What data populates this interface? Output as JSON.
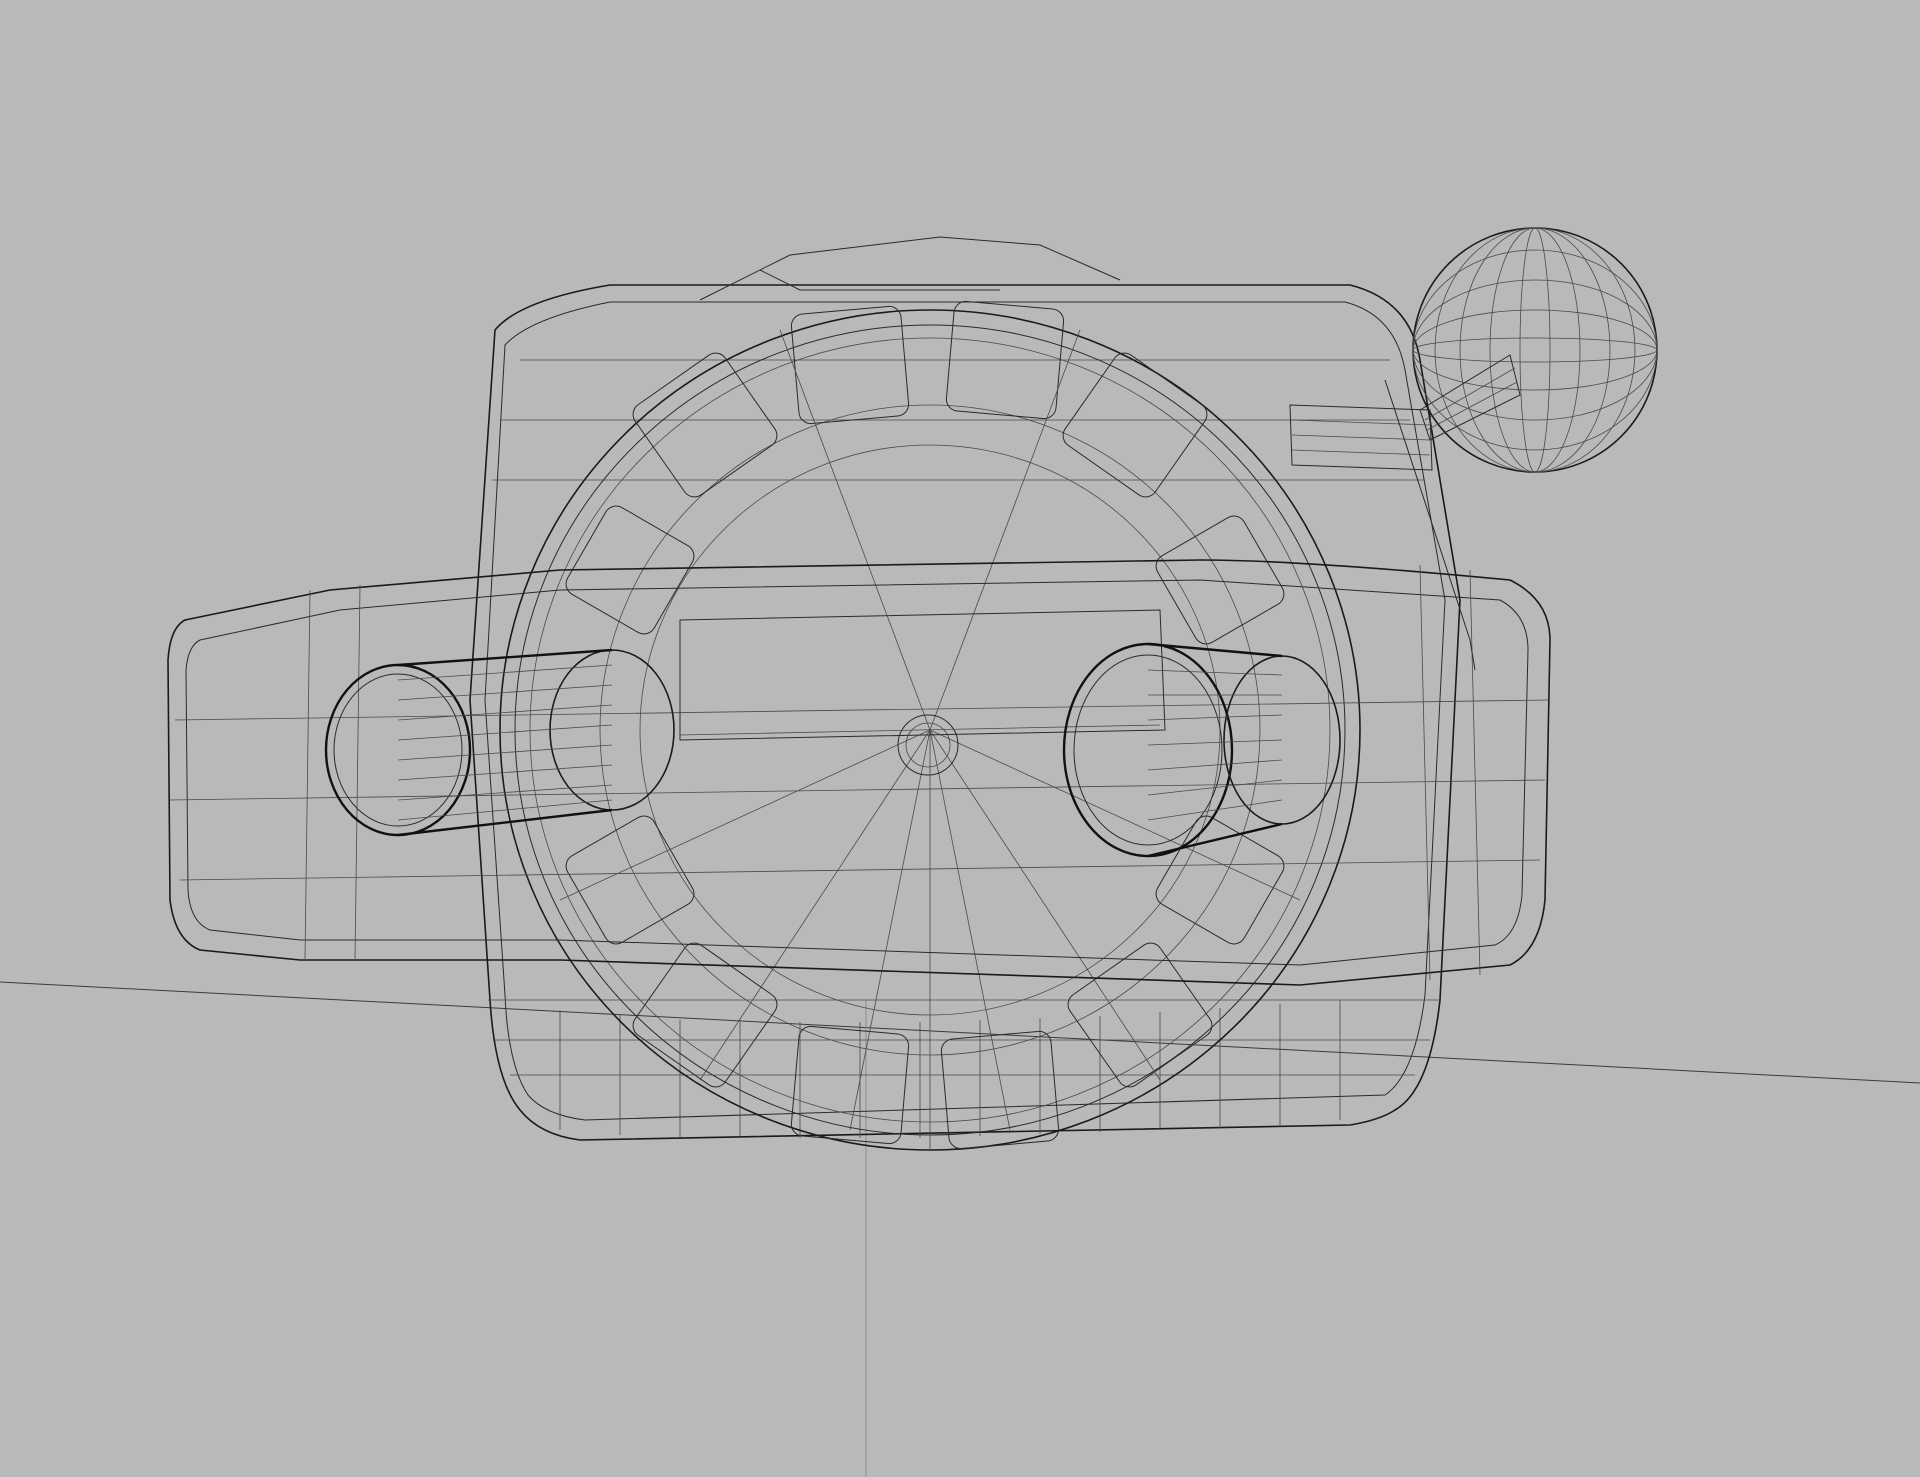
{
  "viewport": {
    "background_color": "#b9b9b9",
    "wire_color": "#2a2a2a",
    "scene_object": "wireframe-3d-model"
  }
}
